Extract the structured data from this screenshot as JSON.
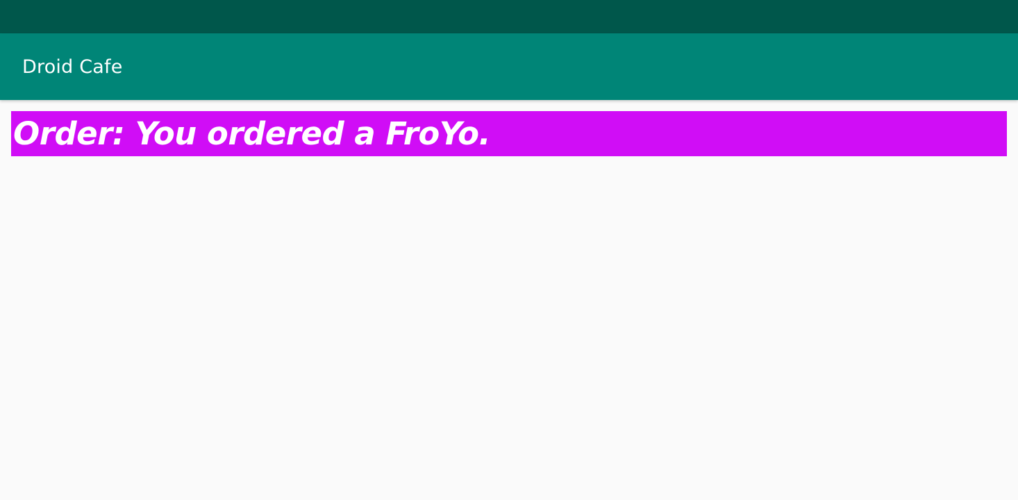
{
  "colors": {
    "status_bar": "#00574b",
    "app_bar": "#008577",
    "app_bar_text": "#ffffff",
    "background": "#fafafa",
    "order_background": "#d00df6",
    "order_text": "#ffffff"
  },
  "app_bar": {
    "title": "Droid Cafe"
  },
  "main": {
    "order_message": "Order: You ordered a FroYo."
  }
}
